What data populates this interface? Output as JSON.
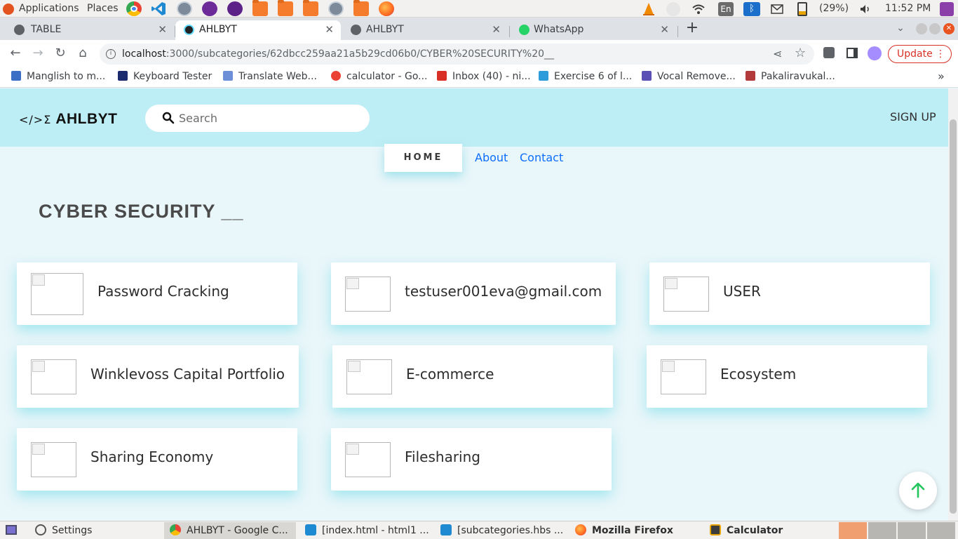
{
  "os_bar": {
    "applications": "Applications",
    "places": "Places",
    "battery": "(29%)",
    "time": "11:52 PM",
    "keyboard_layout": "En"
  },
  "browser": {
    "tabs": [
      {
        "title": "TABLE",
        "active": false
      },
      {
        "title": "AHLBYT",
        "active": true
      },
      {
        "title": "AHLBYT",
        "active": false
      },
      {
        "title": "WhatsApp",
        "active": false
      }
    ],
    "url_host": "localhost",
    "url_path": ":3000/subcategories/62dbcc259aa21a5b29cd06b0/CYBER%20SECURITY%20__",
    "update_label": "Update",
    "bookmarks": [
      "Manglish to m...",
      "Keyboard Tester",
      "Translate Web...",
      "calculator - Go...",
      "Inbox (40) - ni...",
      "Exercise 6 of l...",
      "Vocal Remove...",
      "Pakaliravukal..."
    ],
    "more_bookmarks": "»"
  },
  "site": {
    "logo_mark": "</>Σ",
    "logo_name": "AHLBYT",
    "search_placeholder": "Search",
    "signup": "SIGN UP",
    "nav": {
      "home": "HOME",
      "about": "About",
      "contact": "Contact"
    },
    "page_title": "CYBER SECURITY __",
    "subcategories": [
      "Password Cracking",
      "testuser001eva@gmail.com",
      "USER",
      "Winklevoss Capital Portfolio",
      "E-commerce",
      "Ecosystem",
      "Sharing Economy",
      "Filesharing"
    ]
  },
  "taskbar": {
    "items": [
      "Settings",
      "AHLBYT - Google C...",
      "[index.html - html1 ...",
      "[subcategories.hbs ...",
      "Mozilla Firefox",
      "Calculator"
    ]
  },
  "colors": {
    "header_bg": "#bdedf5",
    "page_bg": "#e9f6fa",
    "link": "#0d6efd",
    "up_arrow": "#22c55e",
    "update_red": "#d93025"
  }
}
